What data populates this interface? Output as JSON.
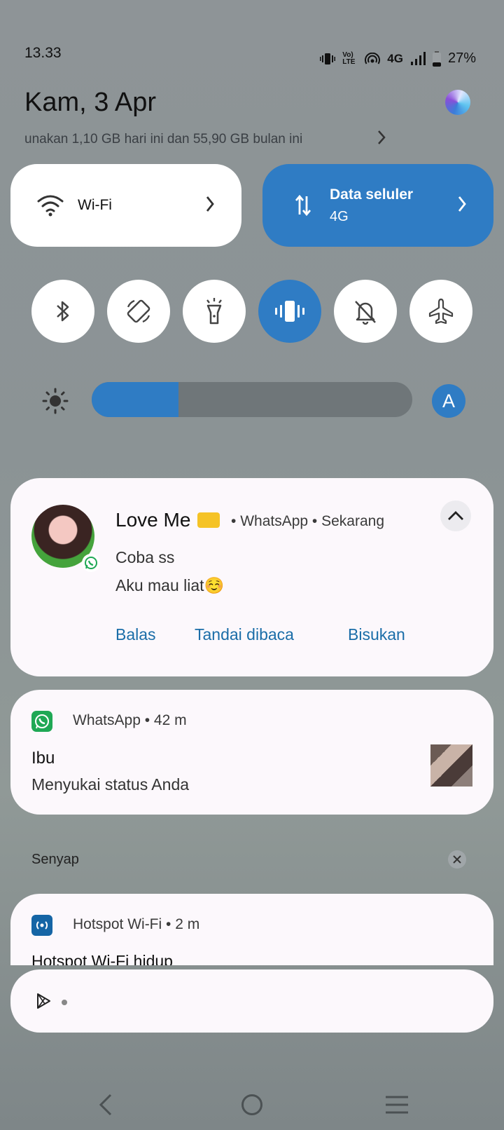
{
  "status_bar": {
    "time": "13.33",
    "volte": "Vo) LTE",
    "network": "4G",
    "battery": "27%"
  },
  "header": {
    "date": "Kam, 3 Apr",
    "data_usage": "unakan 1,10 GB hari ini dan 55,90 GB bulan ini"
  },
  "tiles": {
    "wifi": {
      "label": "Wi-Fi"
    },
    "data": {
      "label": "Data seluler",
      "sub": "4G"
    }
  },
  "toggles": [
    {
      "name": "bluetooth",
      "on": false
    },
    {
      "name": "auto-rotate",
      "on": false
    },
    {
      "name": "flashlight",
      "on": false
    },
    {
      "name": "vibrate",
      "on": true
    },
    {
      "name": "do-not-disturb",
      "on": false
    },
    {
      "name": "airplane-mode",
      "on": false
    }
  ],
  "brightness": {
    "level": 0.27,
    "auto_label": "A"
  },
  "notifications": {
    "message": {
      "sender": "Love Me",
      "app": "WhatsApp",
      "time": "Sekarang",
      "lines": [
        "Coba ss",
        "Aku mau liat☺️"
      ],
      "actions": [
        "Balas",
        "Tandai dibaca",
        "Bisukan"
      ]
    },
    "status": {
      "app": "WhatsApp",
      "time": "42 m",
      "title": "Ibu",
      "body": "Menyukai status Anda"
    },
    "silent_section": "Senyap",
    "hotspot": {
      "app": "Hotspot Wi-Fi",
      "time": "2 m",
      "title": "Hotspot Wi-Fi hidup"
    }
  },
  "colors": {
    "accent": "#2f7cc4",
    "action_text": "#1a6da8",
    "whatsapp": "#25d366"
  }
}
